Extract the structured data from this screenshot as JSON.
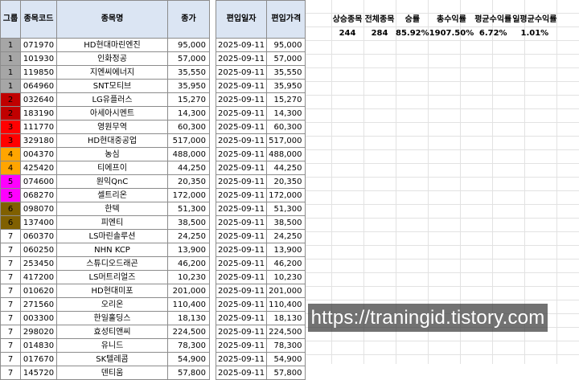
{
  "headers": [
    "그룹",
    "종목코드",
    "종목명",
    "종가",
    "편입일자",
    "편입가격"
  ],
  "stats": {
    "labels": [
      "상승종목",
      "전체종목",
      "승률",
      "총수익률",
      "평균수익률",
      "일평균수익률"
    ],
    "values": [
      "244",
      "284",
      "85.92%",
      "1907.50%",
      "6.72%",
      "1.01%"
    ]
  },
  "group_colors": {
    "1": "#a6a6a6",
    "2": "#c00000",
    "3": "#ff0000",
    "4": "#ffa500",
    "5": "#ff00ff",
    "6": "#806000",
    "7": "#ffffff"
  },
  "rows": [
    [
      "1",
      "071970",
      "HD현대마린엔진",
      "95,000",
      "2025-09-11",
      "95,000"
    ],
    [
      "1",
      "101930",
      "인화정공",
      "57,000",
      "2025-09-11",
      "57,000"
    ],
    [
      "1",
      "119850",
      "지엔씨에너지",
      "35,550",
      "2025-09-11",
      "35,550"
    ],
    [
      "1",
      "064960",
      "SNT모티브",
      "35,950",
      "2025-09-11",
      "35,950"
    ],
    [
      "2",
      "032640",
      "LG유플러스",
      "15,270",
      "2025-09-11",
      "15,270"
    ],
    [
      "2",
      "183190",
      "아세아시멘트",
      "14,300",
      "2025-09-11",
      "14,300"
    ],
    [
      "3",
      "111770",
      "영원무역",
      "60,300",
      "2025-09-11",
      "60,300"
    ],
    [
      "3",
      "329180",
      "HD현대중공업",
      "517,000",
      "2025-09-11",
      "517,000"
    ],
    [
      "4",
      "004370",
      "농심",
      "488,000",
      "2025-09-11",
      "488,000"
    ],
    [
      "4",
      "425420",
      "티에프이",
      "44,250",
      "2025-09-11",
      "44,250"
    ],
    [
      "5",
      "074600",
      "원익QnC",
      "20,350",
      "2025-09-11",
      "20,350"
    ],
    [
      "5",
      "068270",
      "셀트리온",
      "172,000",
      "2025-09-11",
      "172,000"
    ],
    [
      "6",
      "098070",
      "한텍",
      "51,300",
      "2025-09-11",
      "51,300"
    ],
    [
      "6",
      "137400",
      "피엔티",
      "38,500",
      "2025-09-11",
      "38,500"
    ],
    [
      "7",
      "060370",
      "LS마린솔루션",
      "24,250",
      "2025-09-11",
      "24,250"
    ],
    [
      "7",
      "060250",
      "NHN KCP",
      "13,900",
      "2025-09-11",
      "13,900"
    ],
    [
      "7",
      "253450",
      "스튜디오드래곤",
      "46,200",
      "2025-09-11",
      "46,200"
    ],
    [
      "7",
      "417200",
      "LS머트리얼즈",
      "10,230",
      "2025-09-11",
      "10,230"
    ],
    [
      "7",
      "010620",
      "HD현대미포",
      "201,000",
      "2025-09-11",
      "201,000"
    ],
    [
      "7",
      "271560",
      "오리온",
      "110,400",
      "2025-09-11",
      "110,400"
    ],
    [
      "7",
      "003300",
      "한일홀딩스",
      "18,130",
      "2025-09-11",
      "18,130"
    ],
    [
      "7",
      "298020",
      "효성티앤씨",
      "224,500",
      "2025-09-11",
      "224,500"
    ],
    [
      "7",
      "014830",
      "유니드",
      "78,300",
      "2025-09-11",
      "78,300"
    ],
    [
      "7",
      "017670",
      "SK텔레콤",
      "54,900",
      "2025-09-11",
      "54,900"
    ],
    [
      "7",
      "145720",
      "덴티움",
      "57,800",
      "2025-09-11",
      "57,800"
    ]
  ],
  "watermark": "https://traningid.tistory.com"
}
